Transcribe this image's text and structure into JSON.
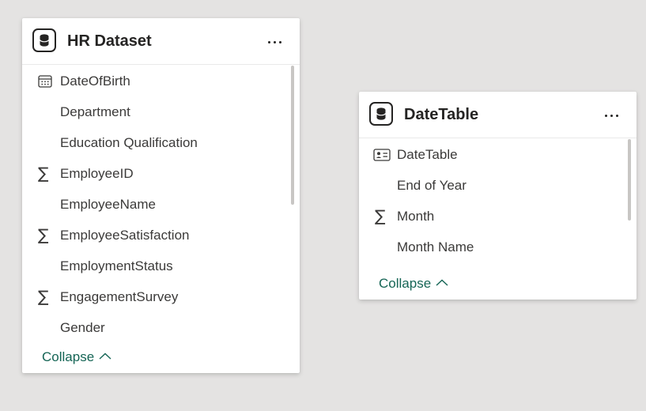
{
  "cards": [
    {
      "title": "HR Dataset",
      "icon": "database-icon",
      "fields": [
        {
          "label": "DateOfBirth",
          "icon": "calendar-icon"
        },
        {
          "label": "Department",
          "icon": ""
        },
        {
          "label": "Education Qualification",
          "icon": ""
        },
        {
          "label": "EmployeeID",
          "icon": "sigma-icon"
        },
        {
          "label": "EmployeeName",
          "icon": ""
        },
        {
          "label": "EmployeeSatisfaction",
          "icon": "sigma-icon"
        },
        {
          "label": "EmploymentStatus",
          "icon": ""
        },
        {
          "label": "EngagementSurvey",
          "icon": "sigma-icon"
        },
        {
          "label": "Gender",
          "icon": ""
        }
      ],
      "collapse_label": "Collapse"
    },
    {
      "title": "DateTable",
      "icon": "database-icon",
      "fields": [
        {
          "label": "DateTable",
          "icon": "id-card-icon"
        },
        {
          "label": "End of Year",
          "icon": ""
        },
        {
          "label": "Month",
          "icon": "sigma-icon"
        },
        {
          "label": "Month Name",
          "icon": ""
        }
      ],
      "collapse_label": "Collapse"
    }
  ],
  "colors": {
    "canvas": "#e4e3e2",
    "card": "#ffffff",
    "link": "#156555",
    "scrollbar": "#c8c6c4"
  }
}
